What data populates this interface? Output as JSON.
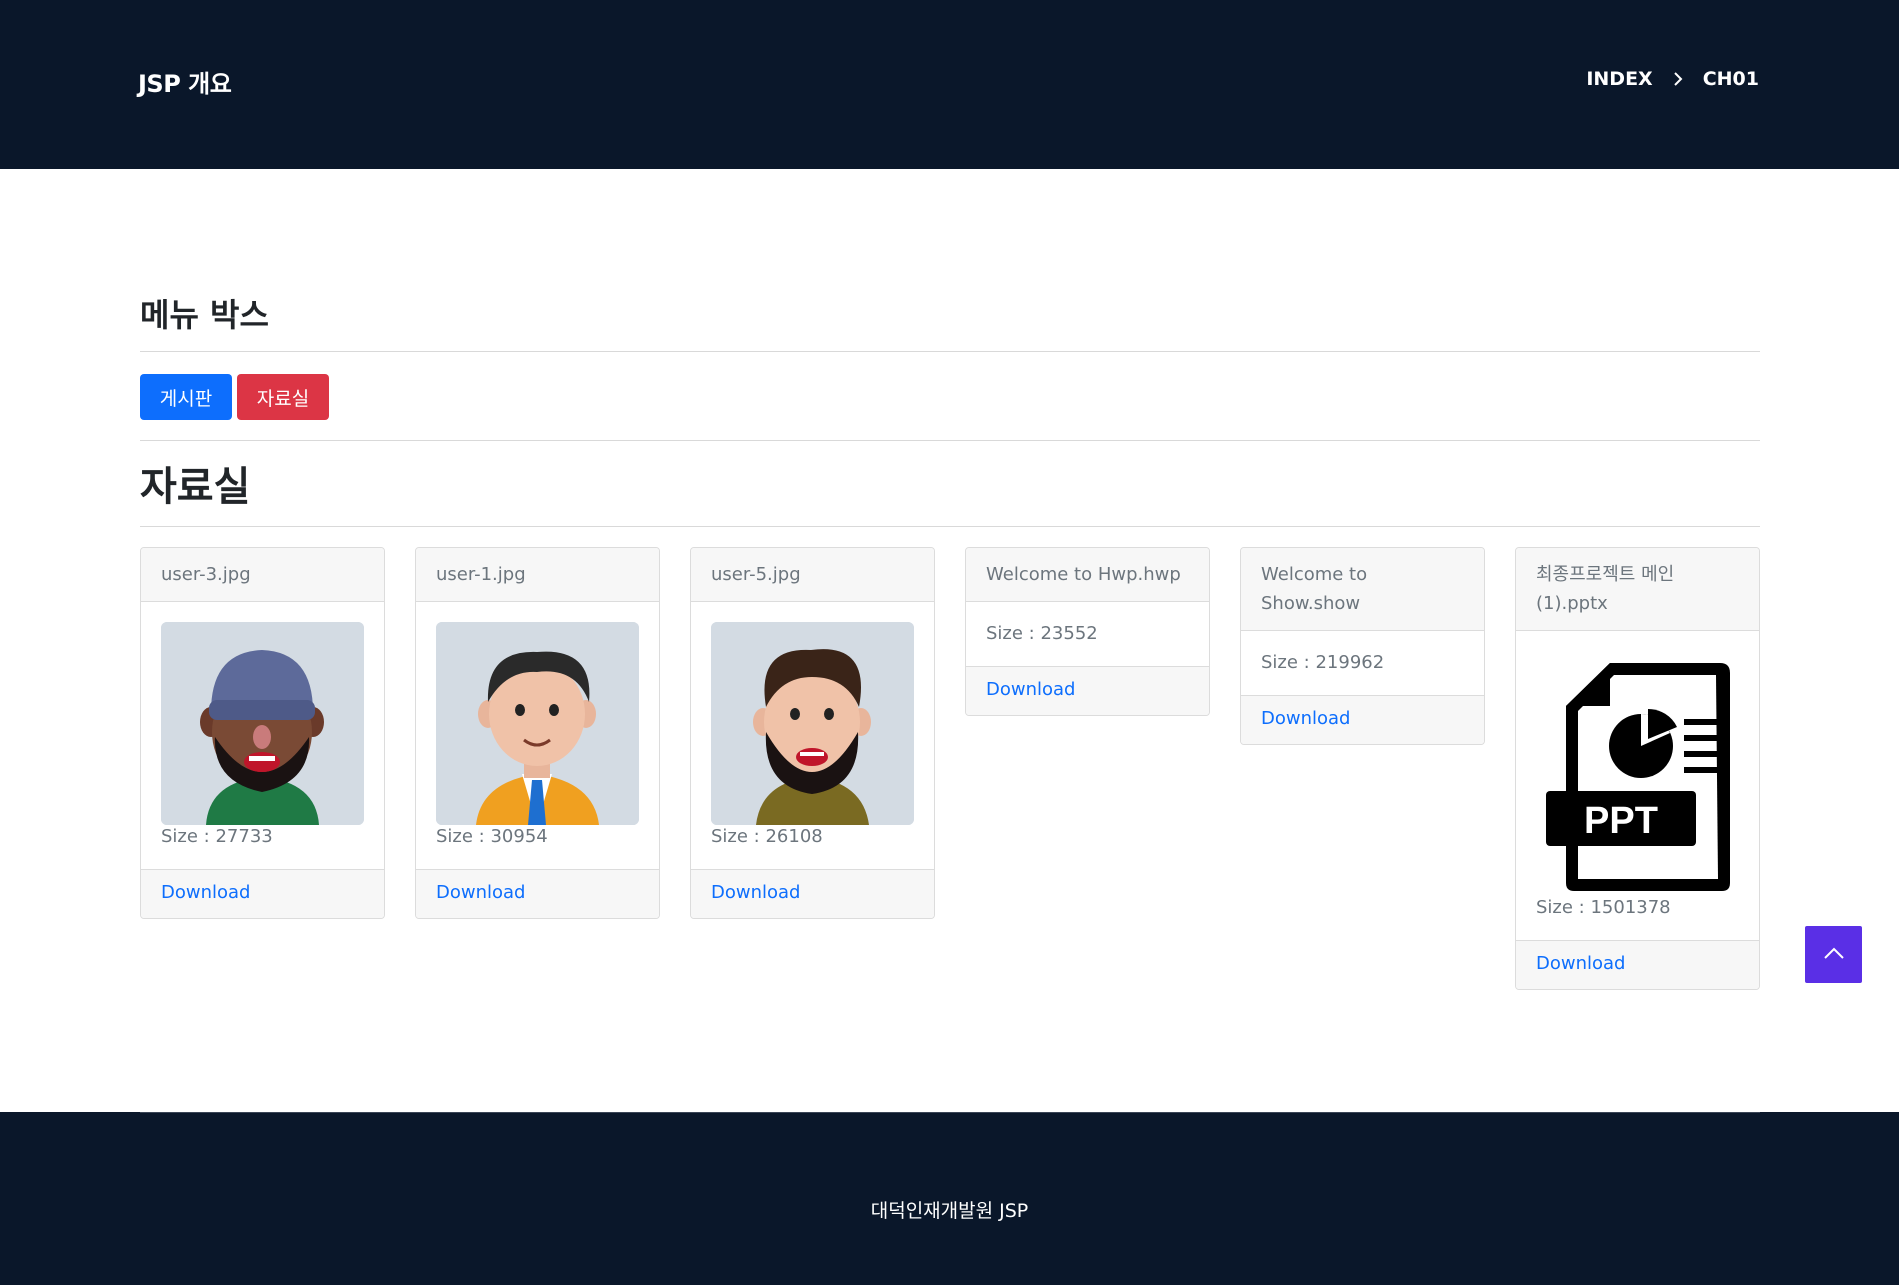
{
  "header": {
    "brand": "JSP 개요",
    "breadcrumb": [
      "INDEX",
      "CH01"
    ]
  },
  "menu_section": {
    "title": "메뉴 박스",
    "buttons": [
      "게시판",
      "자료실"
    ]
  },
  "files_section": {
    "title": "자료실",
    "cards": [
      {
        "name": "user-3.jpg",
        "size": "Size : 27733",
        "download": "Download",
        "preview": "avatar-beanie"
      },
      {
        "name": "user-1.jpg",
        "size": "Size : 30954",
        "download": "Download",
        "preview": "avatar-jacket"
      },
      {
        "name": "user-5.jpg",
        "size": "Size : 26108",
        "download": "Download",
        "preview": "avatar-beard"
      },
      {
        "name": "Welcome to Hwp.hwp",
        "size": "Size : 23552",
        "download": "Download"
      },
      {
        "name": "Welcome to Show.show",
        "size": "Size : 219962",
        "download": "Download"
      },
      {
        "name": "최종프로젝트 메인 (1).pptx",
        "size": "Size : 1501378",
        "download": "Download",
        "preview": "ppt-file-icon",
        "preview_text": "PPT"
      }
    ]
  },
  "footer": {
    "text": "대덕인재개발원 JSP"
  },
  "colors": {
    "header_bg": "#0a172a",
    "primary": "#0d6efd",
    "danger": "#dc3545",
    "scroll_top": "#5a2fe6"
  }
}
